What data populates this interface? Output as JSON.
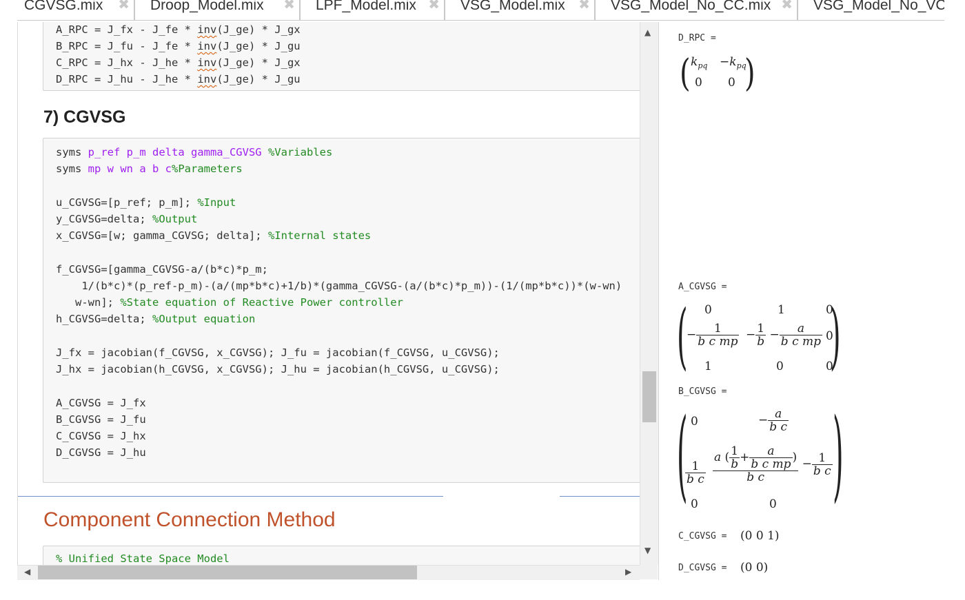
{
  "tabs": [
    {
      "label": "CGVSG.mix",
      "close": "✖",
      "active": true
    },
    {
      "label": "Droop_Model.mix",
      "close": "✖",
      "active": false
    },
    {
      "label": "LPF_Model.mix",
      "close": "✖",
      "active": false
    },
    {
      "label": "VSG_Model.mix",
      "close": "✖",
      "active": false
    },
    {
      "label": "VSG_Model_No_CC.mix",
      "close": "✖",
      "active": false
    },
    {
      "label": "VSG_Model_No_VC.mix",
      "close": "",
      "active": false
    }
  ],
  "rpc_code": {
    "line1": [
      "A_RPC = J_fx - J_fe * ",
      "inv",
      "(J_ge) * J_gx"
    ],
    "line2": [
      "B_RPC = J_fu - J_fe * ",
      "inv",
      "(J_ge) * J_gu"
    ],
    "line3": [
      "C_RPC = J_hx - J_he * ",
      "inv",
      "(J_ge) * J_gx"
    ],
    "line4": [
      "D_RPC = J_hu - J_he * ",
      "inv",
      "(J_ge) * J_gu"
    ]
  },
  "section7_heading": "7) CGVSG",
  "cgvsg_code": {
    "l1_kw": "syms ",
    "l1_vars": "p_ref p_m delta gamma_CGVSG ",
    "l1_cm": "%Variables",
    "l2_kw": "syms ",
    "l2_vars": "mp w wn a b c",
    "l2_cm": "%Parameters",
    "l3": "u_CGVSG=[p_ref; p_m]; ",
    "l3_cm": "%Input",
    "l4": "y_CGVSG=delta; ",
    "l4_cm": "%Output",
    "l5": "x_CGVSG=[w; gamma_CGVSG; delta]; ",
    "l5_cm": "%Internal states",
    "l6": "f_CGVSG=[gamma_CGVSG-a/(b*c)*p_m;",
    "l7": "    1/(b*c)*(p_ref-p_m)-(a/(mp*b*c)+1/b)*(gamma_CGVSG-(a/(b*c)*p_m))-(1/(mp*b*c))*(w-wn)",
    "l8": "   w-wn]; ",
    "l8_cm": "%State equation of Reactive Power controller",
    "l9": "h_CGVSG=delta; ",
    "l9_cm": "%Output equation",
    "l10": "J_fx = jacobian(f_CGVSG, x_CGVSG); J_fu = jacobian(f_CGVSG, u_CGVSG);",
    "l11": "J_hx = jacobian(h_CGVSG, x_CGVSG); J_hu = jacobian(h_CGVSG, u_CGVSG);",
    "l12": "A_CGVSG = J_fx",
    "l13": "B_CGVSG = J_fu",
    "l14": "C_CGVSG = J_hx",
    "l15": "D_CGVSG = J_hu"
  },
  "section_title": "Component Connection Method",
  "next_code_line": "% Unified State Space Model",
  "output": {
    "d_rpc_label": "D_RPC =",
    "a_cgvsg_label": "A_CGVSG =",
    "b_cgvsg_label": "B_CGVSG =",
    "c_cgvsg_label": "C_CGVSG =",
    "d_cgvsg_label": "D_CGVSG =",
    "c_cgvsg_value": "(0  0  1)",
    "d_cgvsg_value": "(0  0)",
    "k": "k",
    "pq": "pq",
    "minus": "−",
    "zero": "0",
    "one": "1",
    "a": "a",
    "b": "b",
    "c": "c",
    "bc": "b c",
    "bcmp": "b c mp"
  },
  "scrollbar_icons": {
    "up": "▲",
    "down": "▼",
    "left": "◀",
    "right": "▶"
  }
}
